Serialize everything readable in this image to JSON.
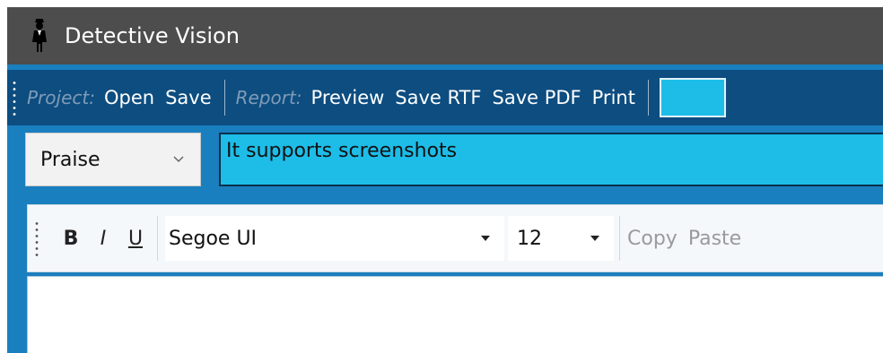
{
  "window": {
    "title": "Detective Vision",
    "icon": "detective-icon"
  },
  "main_toolbar": {
    "project_label": "Project:",
    "open_label": "Open",
    "save_label": "Save",
    "report_label": "Report:",
    "preview_label": "Preview",
    "save_rtf_label": "Save RTF",
    "save_pdf_label": "Save PDF",
    "print_label": "Print"
  },
  "entry": {
    "category_value": "Praise",
    "title_value": "It supports screenshots"
  },
  "format_toolbar": {
    "bold_label": "B",
    "italic_label": "I",
    "underline_label": "U",
    "font_value": "Segoe UI",
    "size_value": "12",
    "copy_label": "Copy",
    "paste_label": "Paste"
  },
  "editor": {
    "content": ""
  },
  "colors": {
    "titlebar": "#4d4d4d",
    "toolbar": "#0d4d80",
    "accent": "#1dbde8",
    "background": "#1a7fbf"
  }
}
